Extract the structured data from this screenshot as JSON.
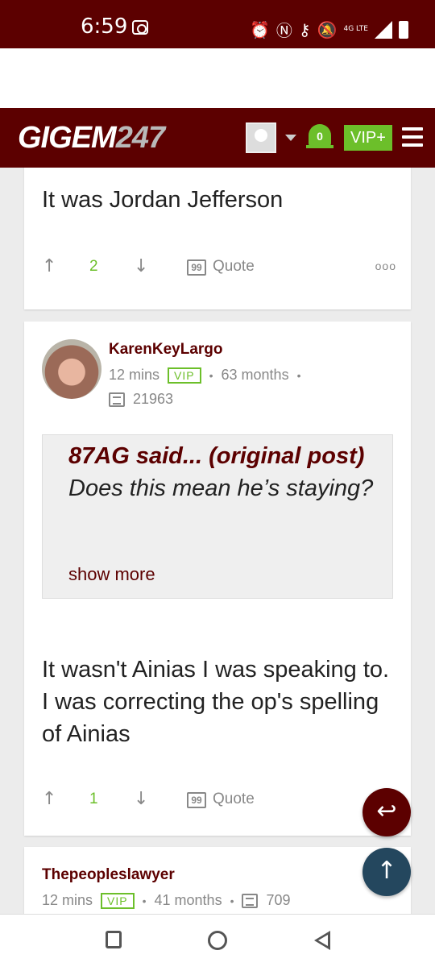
{
  "status_bar": {
    "time": "6:59",
    "network": "4G LTE"
  },
  "site": {
    "logo_main": "GIGEM",
    "logo_num": "247",
    "notifications": "0",
    "vip_label": "VIP+"
  },
  "posts": [
    {
      "body": "It was Jordan Jefferson",
      "upvotes": "2",
      "quote_label": "Quote",
      "more": "ooo"
    },
    {
      "username": "KarenKeyLargo",
      "time": "12 mins",
      "badge": "VIP",
      "tenure": "63 months",
      "post_count": "21963",
      "quote": {
        "author": "87AG said... (original post)",
        "text": "Does this mean he’s staying?",
        "show_more": "show more"
      },
      "body": "It wasn't Ainias I was speaking to. I was correcting the op's spelling of Ainias",
      "upvotes": "1",
      "quote_label": "Quote"
    },
    {
      "username": "Thepeopleslawyer",
      "time": "12 mins",
      "badge": "VIP",
      "tenure": "41 months",
      "post_count": "709"
    }
  ],
  "colors": {
    "brand": "#5c0000",
    "vip_green": "#6cbf2a",
    "scroll_top": "#24475e"
  }
}
